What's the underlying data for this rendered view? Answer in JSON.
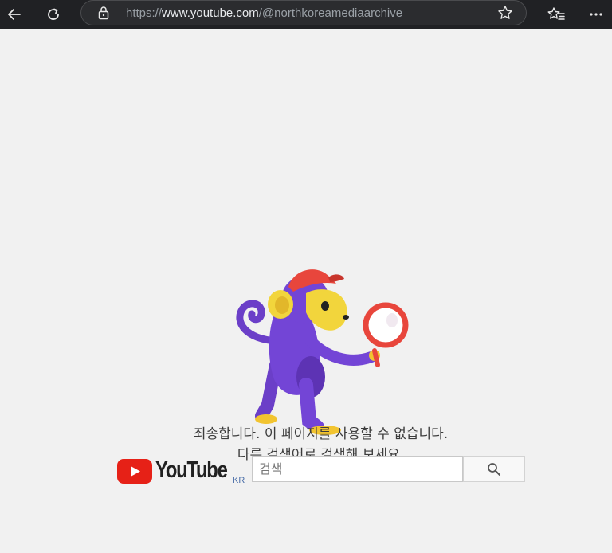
{
  "browser": {
    "url_prefix": "https://",
    "url_host": "www.youtube.com",
    "url_path": "/@northkoreamediaarchive"
  },
  "error": {
    "line1": "죄송합니다. 이 페이지를 사용할 수 없습니다.",
    "line2": "다른 검색어로 검색해 보세요."
  },
  "logo": {
    "wordmark": "YouTube",
    "region": "KR"
  },
  "search": {
    "placeholder": "검색"
  },
  "icons": [
    "back-icon",
    "refresh-icon",
    "lock-icon",
    "star-icon",
    "favorites-icon",
    "more-icon",
    "search-icon",
    "youtube-play-icon"
  ],
  "colors": {
    "toolbar": "#202124",
    "page_bg": "#f1f1f1",
    "youtube_red": "#e62117"
  }
}
